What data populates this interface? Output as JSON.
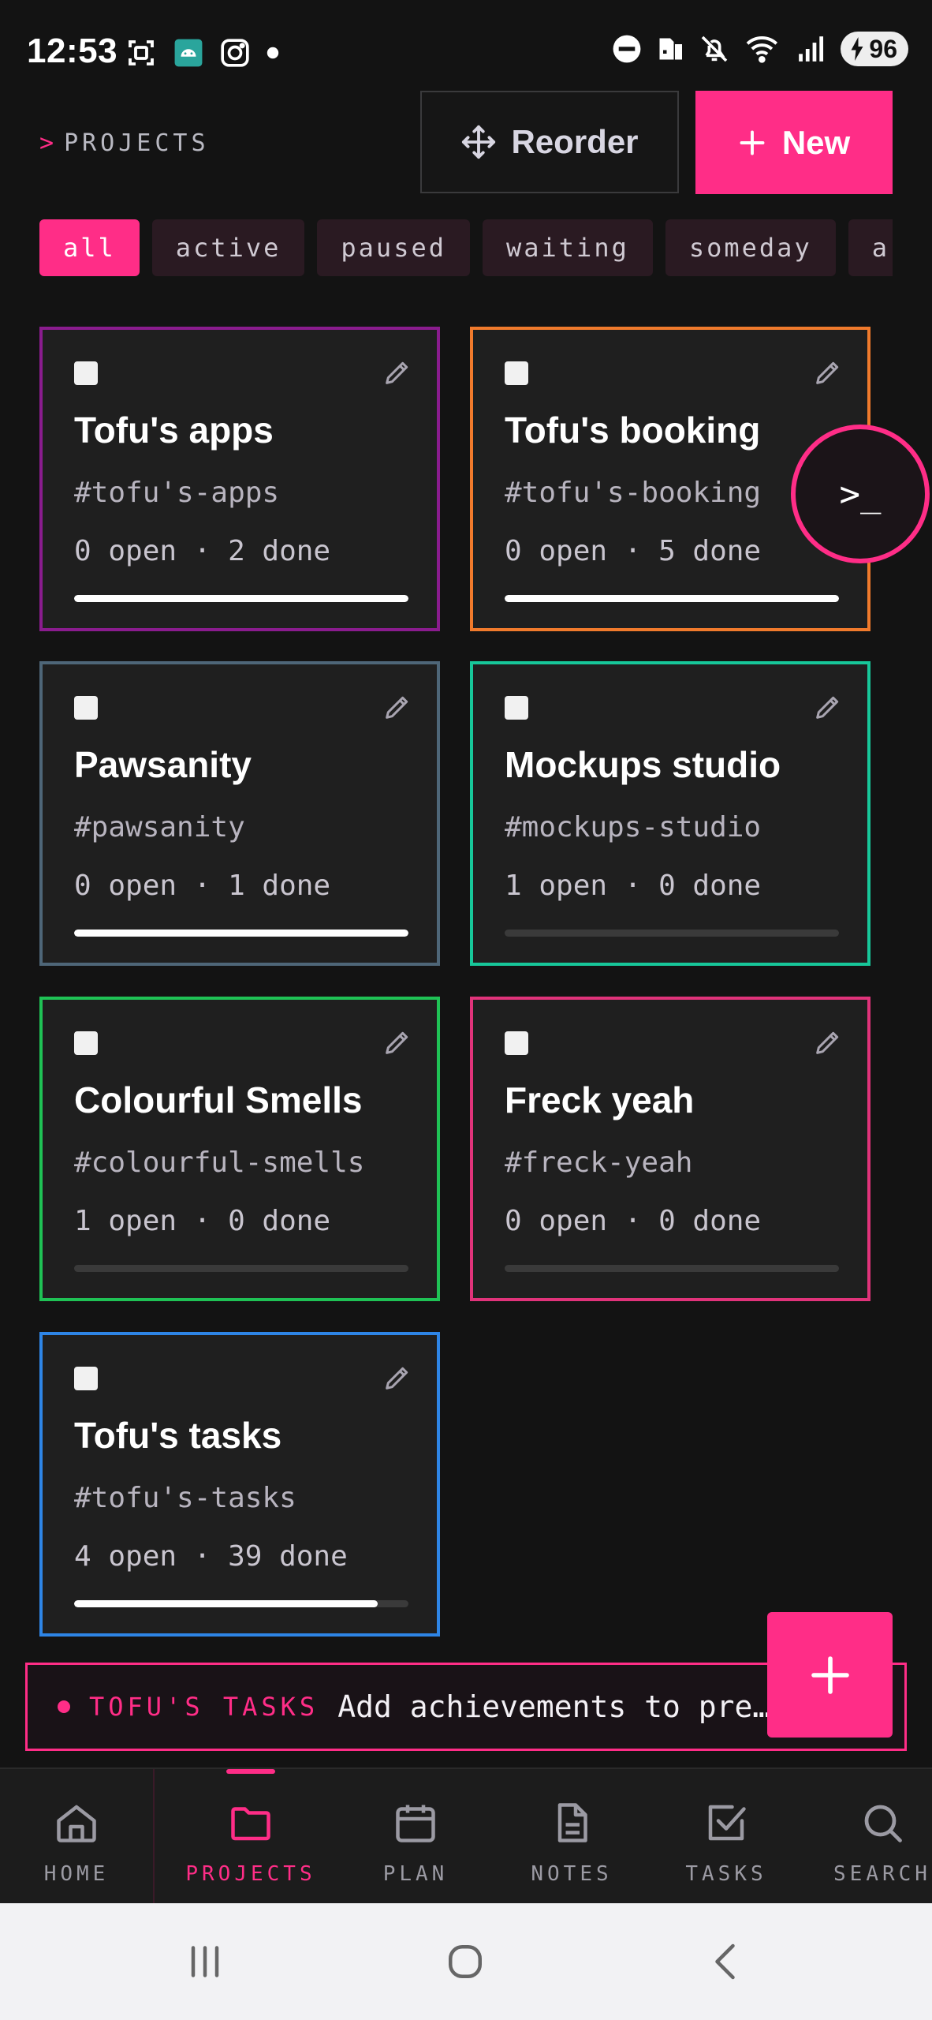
{
  "status_bar": {
    "time": "12:53",
    "battery": "96",
    "left_icons": [
      "screenshot-icon",
      "android-icon",
      "instagram-icon",
      "dot-icon"
    ],
    "right_icons": [
      "dnd-icon",
      "sim-icon",
      "mute-icon",
      "wifi-icon",
      "signal-icon",
      "battery-icon"
    ]
  },
  "header": {
    "breadcrumb_caret": ">",
    "breadcrumb": "PROJECTS",
    "reorder_label": "Reorder",
    "new_label": "New"
  },
  "filters": [
    "all",
    "active",
    "paused",
    "waiting",
    "someday",
    "a"
  ],
  "selected_filter": "all",
  "projects": [
    {
      "title": "Tofu's apps",
      "tag": "#tofu's-apps",
      "stats": "0 open · 2 done",
      "progress": 1.0,
      "border": "#8a1c8e"
    },
    {
      "title": "Tofu's booking",
      "tag": "#tofu's-booking",
      "stats": "0 open · 5 done",
      "progress": 1.0,
      "border": "#f07a2c"
    },
    {
      "title": "Pawsanity",
      "tag": "#pawsanity",
      "stats": "0 open · 1 done",
      "progress": 1.0,
      "border": "#4e6678"
    },
    {
      "title": "Mockups studio",
      "tag": "#mockups-studio",
      "stats": "1 open · 0 done",
      "progress": 0.0,
      "border": "#17c79a"
    },
    {
      "title": "Colourful Smells",
      "tag": "#colourful-smells",
      "stats": "1 open · 0 done",
      "progress": 0.0,
      "border": "#1fc255"
    },
    {
      "title": "Freck yeah",
      "tag": "#freck-yeah",
      "stats": "0 open · 0 done",
      "progress": 0.0,
      "border": "#e0337a"
    },
    {
      "title": "Tofu's tasks",
      "tag": "#tofu's-tasks",
      "stats": "4 open · 39 done",
      "progress": 0.907,
      "border": "#2e85e6"
    }
  ],
  "terminal_fab_label": ">_",
  "active_task": {
    "project": "TOFU'S TASKS",
    "text": "Add achievements to pre…"
  },
  "nav": [
    {
      "label": "HOME",
      "icon": "home-icon"
    },
    {
      "label": "PROJECTS",
      "icon": "folder-icon"
    },
    {
      "label": "PLAN",
      "icon": "calendar-icon"
    },
    {
      "label": "NOTES",
      "icon": "note-icon"
    },
    {
      "label": "TASKS",
      "icon": "checkbox-icon"
    },
    {
      "label": "SEARCH",
      "icon": "search-icon"
    }
  ],
  "active_nav": "PROJECTS",
  "colors": {
    "accent": "#ff2d87",
    "background": "#131313",
    "card": "#1f1f1f"
  }
}
